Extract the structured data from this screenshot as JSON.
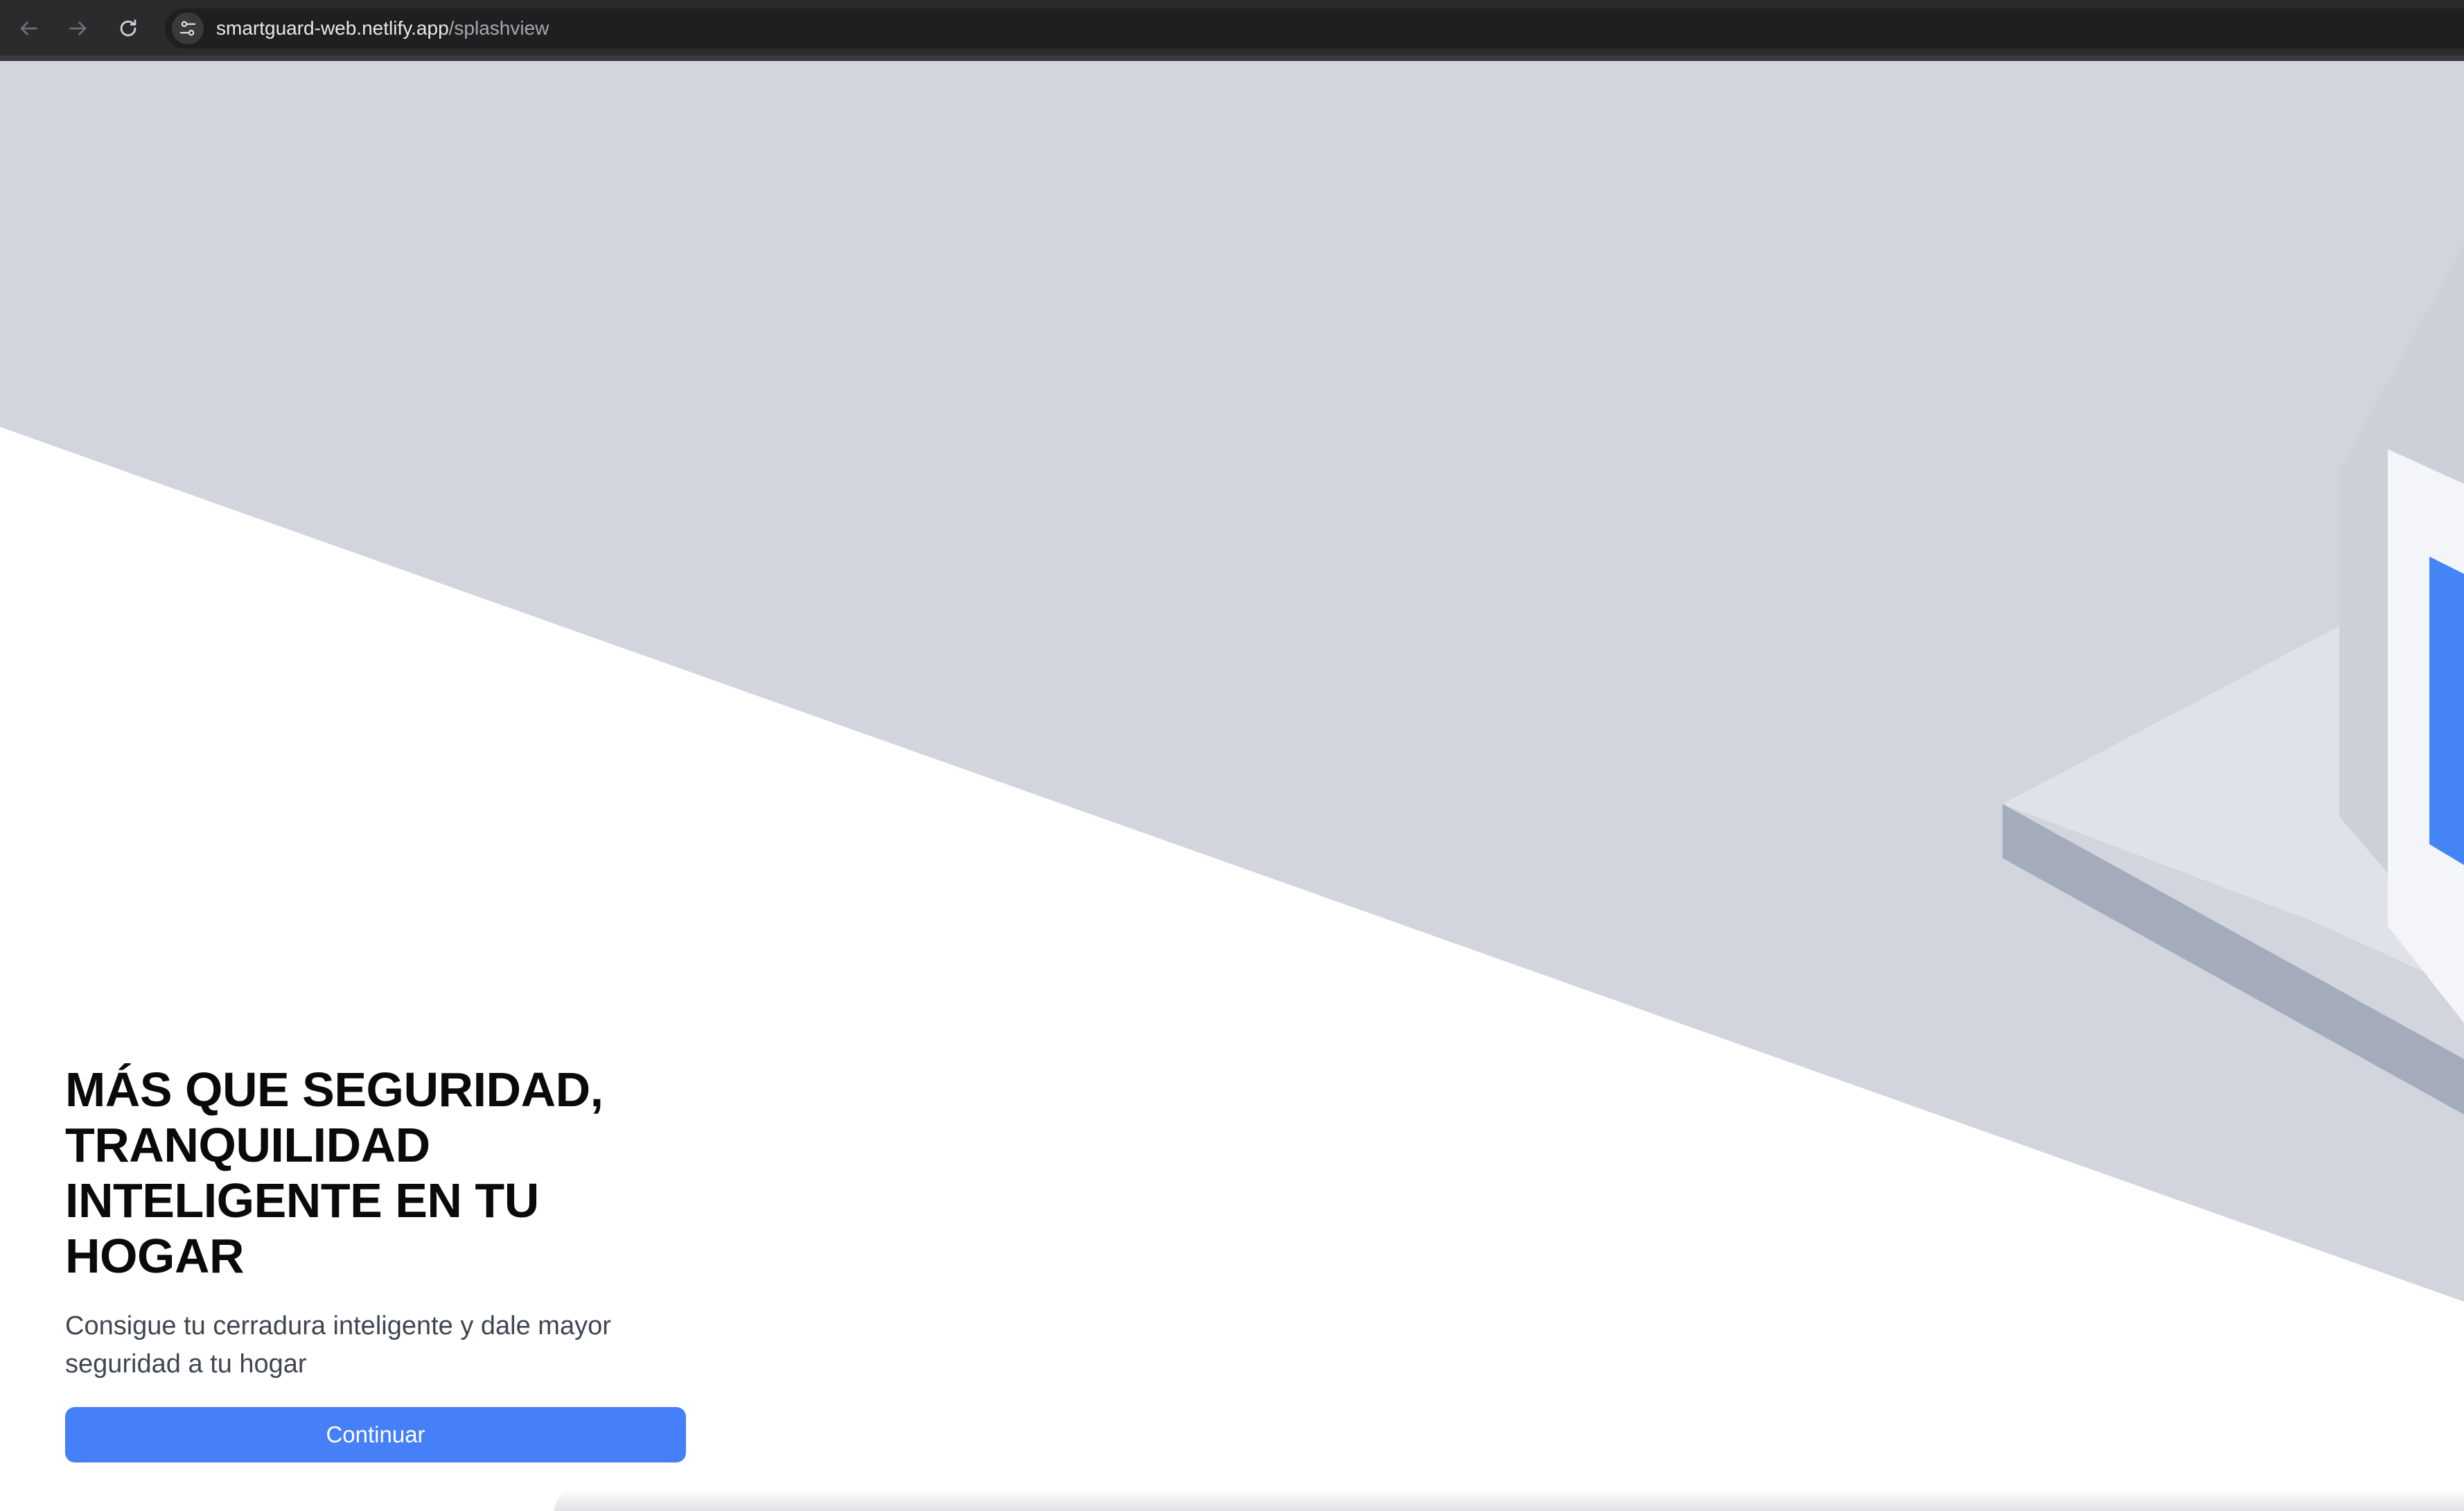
{
  "browser": {
    "url_host": "smartguard-web.netlify.app",
    "url_path": "/splashview",
    "back_icon": "arrow-left-icon",
    "forward_icon": "arrow-right-icon",
    "reload_icon": "reload-icon",
    "site_info_icon": "tune-icon"
  },
  "hero": {
    "headline": "MÁS QUE SEGURIDAD,\nTRANQUILIDAD\nINTELIGENTE EN TU\nHOGAR",
    "subtitle": "Consigue tu cerradura inteligente y dale mayor\nseguridad a tu hogar",
    "continue_label": "Continuar"
  },
  "colors": {
    "accent": "#4680f9",
    "hero_background": "#d2d5de",
    "illustration_base": "#a4acbb",
    "illustration_screen": "#4584f5"
  }
}
